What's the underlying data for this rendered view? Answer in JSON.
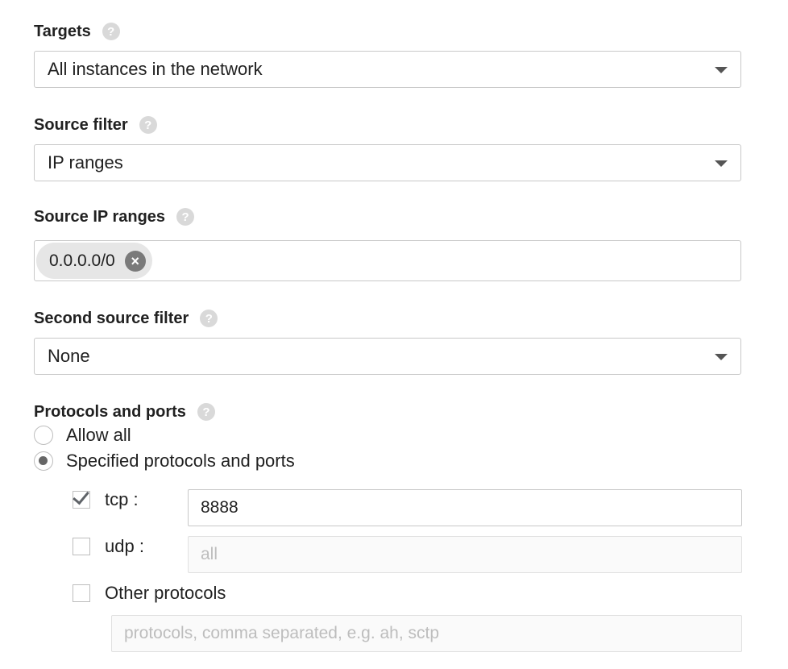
{
  "targets": {
    "label": "Targets",
    "help_icon": "?",
    "selected": "All instances in the network"
  },
  "source_filter": {
    "label": "Source filter",
    "help_icon": "?",
    "selected": "IP ranges"
  },
  "source_ip_ranges": {
    "label": "Source IP ranges",
    "help_icon": "?",
    "chips": [
      "0.0.0.0/0"
    ]
  },
  "second_source_filter": {
    "label": "Second source filter",
    "help_icon": "?",
    "selected": "None"
  },
  "protocols_and_ports": {
    "label": "Protocols and ports",
    "help_icon": "?",
    "options": [
      {
        "label": "Allow all",
        "checked": false
      },
      {
        "label": "Specified protocols and ports",
        "checked": true
      }
    ],
    "tcp": {
      "label": "tcp :",
      "checked": true,
      "value": "8888"
    },
    "udp": {
      "label": "udp :",
      "checked": false,
      "placeholder": "all"
    },
    "other": {
      "label": "Other protocols",
      "checked": false,
      "placeholder": "protocols, comma separated, e.g. ah, sctp"
    }
  }
}
